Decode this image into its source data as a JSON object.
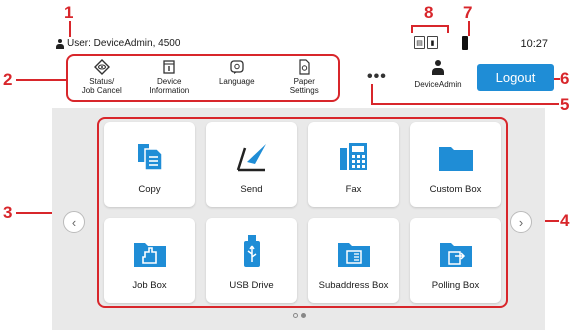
{
  "callouts": [
    "1",
    "2",
    "3",
    "4",
    "5",
    "6",
    "7",
    "8"
  ],
  "status_bar": {
    "user_text": "User: DeviceAdmin, 4500",
    "time": "10:27",
    "icons": [
      "paper-jam-icon",
      "sd-card-icon",
      "toner-icon"
    ]
  },
  "quick_panel": {
    "items": [
      {
        "label": "Status/\nJob Cancel",
        "icon": "status-eye-icon"
      },
      {
        "label": "Device\nInformation",
        "icon": "device-info-icon"
      },
      {
        "label": "Language",
        "icon": "language-icon"
      },
      {
        "label": "Paper\nSettings",
        "icon": "paper-settings-icon"
      }
    ]
  },
  "more_button": "•••",
  "user": {
    "name": "DeviceAdmin"
  },
  "logout_label": "Logout",
  "tiles": [
    {
      "label": "Copy",
      "icon": "copy-icon"
    },
    {
      "label": "Send",
      "icon": "send-icon"
    },
    {
      "label": "Fax",
      "icon": "fax-icon"
    },
    {
      "label": "Custom Box",
      "icon": "folder-icon"
    },
    {
      "label": "Job Box",
      "icon": "job-box-icon"
    },
    {
      "label": "USB Drive",
      "icon": "usb-icon"
    },
    {
      "label": "Subaddress Box",
      "icon": "subaddress-box-icon"
    },
    {
      "label": "Polling Box",
      "icon": "polling-box-icon"
    }
  ],
  "nav": {
    "prev": "‹",
    "next": "›"
  },
  "colors": {
    "callout": "#d8262b",
    "accent": "#1f8dd6",
    "icon_blue": "#1f8dd6",
    "background": "#e9e9e9"
  }
}
